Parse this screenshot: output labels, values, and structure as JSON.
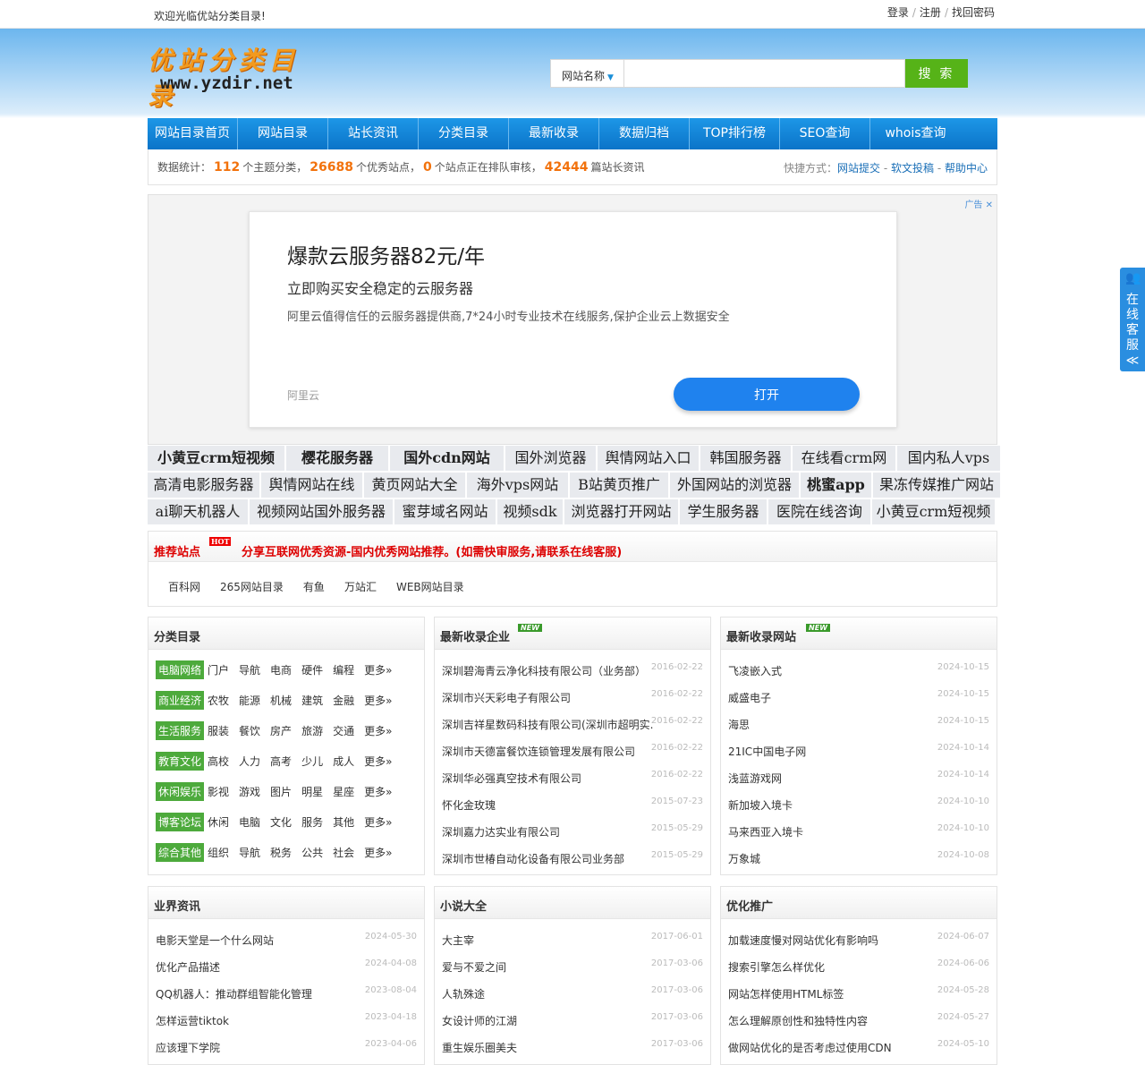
{
  "topbar": {
    "welcome": "欢迎光临优站分类目录!",
    "login": "登录",
    "register": "注册",
    "forgot": "找回密码"
  },
  "logo": {
    "cn": "优站分类目录",
    "en": "www.yzdir.net"
  },
  "search": {
    "type": "网站名称",
    "placeholder": "",
    "button": "搜 索"
  },
  "nav": [
    "网站目录首页",
    "网站目录",
    "站长资讯",
    "分类目录",
    "最新收录",
    "数据归档",
    "TOP排行榜",
    "SEO查询",
    "whois查询"
  ],
  "stats": {
    "prefix": "数据统计：",
    "cat_count": "112",
    "cat_label": "个主题分类，",
    "site_count": "26688",
    "site_label": "个优秀站点，",
    "pending_count": "0",
    "pending_label": "个站点正在排队审核，",
    "news_count": "42444",
    "news_label": "篇站长资讯",
    "shortcut_label": "快捷方式：",
    "shortcuts": [
      "网站提交",
      "软文投稿",
      "帮助中心"
    ]
  },
  "ad": {
    "tag": "广告 ✕",
    "title": "爆款云服务器82元/年",
    "subtitle": "立即购买安全稳定的云服务器",
    "desc": "阿里云值得信任的云服务器提供商,7*24小时专业技术在线服务,保护企业云上数据安全",
    "brand": "阿里云",
    "button": "打开"
  },
  "text_links": [
    [
      {
        "t": "小黄豆crm短视频",
        "w": 153,
        "b": true
      },
      {
        "t": "樱花服务器",
        "w": 114,
        "b": true
      },
      {
        "t": "国外cdn网站",
        "w": 127,
        "b": true
      },
      {
        "t": "国外浏览器",
        "w": 101
      },
      {
        "t": "舆情网站入口",
        "w": 113
      },
      {
        "t": "韩国服务器",
        "w": 101
      },
      {
        "t": "在线看crm网",
        "w": 115
      },
      {
        "t": "国内私人vps",
        "w": 115
      }
    ],
    [
      {
        "t": "高清电影服务器",
        "w": 125
      },
      {
        "t": "舆情网站在线",
        "w": 113
      },
      {
        "t": "黄页网站大全",
        "w": 113
      },
      {
        "t": "海外vps网站",
        "w": 113
      },
      {
        "t": "B站黄页推广",
        "w": 110
      },
      {
        "t": "外国网站的浏览器",
        "w": 144
      },
      {
        "t": "桃蜜app",
        "w": 79,
        "b": true
      },
      {
        "t": "果冻传媒推广网站",
        "w": 142
      }
    ],
    [
      {
        "t": "ai聊天机器人",
        "w": 112
      },
      {
        "t": "视频网站国外服务器",
        "w": 160
      },
      {
        "t": "蜜芽域名网站",
        "w": 113
      },
      {
        "t": "视频sdk",
        "w": 73
      },
      {
        "t": "浏览器打开网站",
        "w": 127
      },
      {
        "t": "学生服务器",
        "w": 97
      },
      {
        "t": "医院在线咨询",
        "w": 114
      },
      {
        "t": "小黄豆crm短视频",
        "w": 137
      }
    ]
  ],
  "recommend": {
    "title": "推荐站点",
    "hot": "HOT",
    "message": "分享互联网优秀资源-国内优秀网站推荐。(如需快审服务,请联系在线客服)",
    "links": [
      "百科网",
      "265网站目录",
      "有鱼",
      "万站汇",
      "WEB网站目录"
    ]
  },
  "categories": {
    "title": "分类目录",
    "more": "更多»",
    "rows": [
      {
        "name": "电脑网络",
        "items": [
          "门户",
          "导航",
          "电商",
          "硬件",
          "编程"
        ]
      },
      {
        "name": "商业经济",
        "items": [
          "农牧",
          "能源",
          "机械",
          "建筑",
          "金融"
        ]
      },
      {
        "name": "生活服务",
        "items": [
          "服装",
          "餐饮",
          "房产",
          "旅游",
          "交通"
        ]
      },
      {
        "name": "教育文化",
        "items": [
          "高校",
          "人力",
          "高考",
          "少儿",
          "成人"
        ]
      },
      {
        "name": "休闲娱乐",
        "items": [
          "影视",
          "游戏",
          "图片",
          "明星",
          "星座"
        ]
      },
      {
        "name": "博客论坛",
        "items": [
          "休闲",
          "电脑",
          "文化",
          "服务",
          "其他"
        ]
      },
      {
        "name": "综合其他",
        "items": [
          "组织",
          "导航",
          "税务",
          "公共",
          "社会"
        ]
      }
    ]
  },
  "latest_companies": {
    "title": "最新收录企业",
    "new": "NEW",
    "items": [
      {
        "t": "深圳碧海青云净化科技有限公司（业务部）",
        "d": "2016-02-22"
      },
      {
        "t": "深圳市兴天彩电子有限公司",
        "d": "2016-02-22"
      },
      {
        "t": "深圳吉祥星数码科技有限公司(深圳市超明实...",
        "d": "2016-02-22"
      },
      {
        "t": "深圳市天德富餐饮连锁管理发展有限公司",
        "d": "2016-02-22"
      },
      {
        "t": "深圳华必强真空技术有限公司",
        "d": "2016-02-22"
      },
      {
        "t": "怀化金玫瑰",
        "d": "2015-07-23"
      },
      {
        "t": "深圳嘉力达实业有限公司",
        "d": "2015-05-29"
      },
      {
        "t": "深圳市世椿自动化设备有限公司业务部",
        "d": "2015-05-29"
      }
    ]
  },
  "latest_sites": {
    "title": "最新收录网站",
    "new": "NEW",
    "items": [
      {
        "t": "飞凌嵌入式",
        "d": "2024-10-15"
      },
      {
        "t": "威盛电子",
        "d": "2024-10-15"
      },
      {
        "t": "海思",
        "d": "2024-10-15"
      },
      {
        "t": "21IC中国电子网",
        "d": "2024-10-14"
      },
      {
        "t": "浅蓝游戏网",
        "d": "2024-10-14"
      },
      {
        "t": "新加坡入境卡",
        "d": "2024-10-10"
      },
      {
        "t": "马来西亚入境卡",
        "d": "2024-10-10"
      },
      {
        "t": "万象城",
        "d": "2024-10-08"
      }
    ]
  },
  "industry_news": {
    "title": "业界资讯",
    "items": [
      {
        "t": "电影天堂是一个什么网站",
        "d": "2024-05-30"
      },
      {
        "t": "优化产品描述",
        "d": "2024-04-08"
      },
      {
        "t": "QQ机器人：推动群组智能化管理",
        "d": "2023-08-04"
      },
      {
        "t": "怎样运营tiktok",
        "d": "2023-04-18"
      },
      {
        "t": "应该理下学院",
        "d": "2023-04-06"
      }
    ]
  },
  "novels": {
    "title": "小说大全",
    "items": [
      {
        "t": "大主宰",
        "d": "2017-06-01"
      },
      {
        "t": "爱与不爱之间",
        "d": "2017-03-06"
      },
      {
        "t": "人轨殊途",
        "d": "2017-03-06"
      },
      {
        "t": "女设计师的江湖",
        "d": "2017-03-06"
      },
      {
        "t": "重生娱乐圈美夫",
        "d": "2017-03-06"
      }
    ]
  },
  "seo": {
    "title": "优化推广",
    "items": [
      {
        "t": "加载速度慢对网站优化有影响吗",
        "d": "2024-06-07"
      },
      {
        "t": "搜索引擎怎么样优化",
        "d": "2024-06-06"
      },
      {
        "t": "网站怎样使用HTML标签",
        "d": "2024-05-28"
      },
      {
        "t": "怎么理解原创性和独特性内容",
        "d": "2024-05-27"
      },
      {
        "t": "做网站优化的是否考虑过使用CDN",
        "d": "2024-05-10"
      }
    ]
  },
  "kefu": {
    "label": "在线客服",
    "arrow": "≪"
  }
}
